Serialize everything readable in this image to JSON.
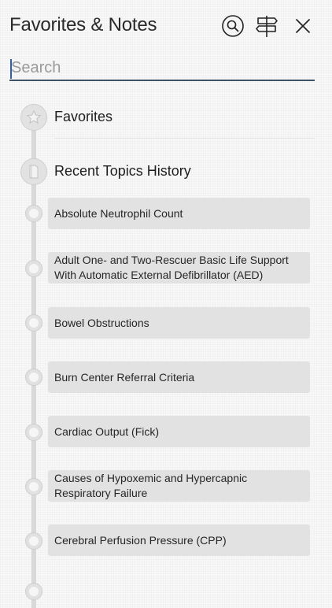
{
  "header": {
    "title": "Favorites & Notes",
    "icons": [
      "search-icon",
      "signpost-icon",
      "close-icon"
    ]
  },
  "search": {
    "placeholder": "Search",
    "value": ""
  },
  "sections": {
    "favorites": {
      "label": "Favorites",
      "icon": "star-icon"
    },
    "history": {
      "label": "Recent Topics History",
      "icon": "document-icon"
    }
  },
  "history_items": [
    "Absolute Neutrophil Count",
    "Adult One- and Two-Rescuer Basic Life Support With Automatic External Defibrillator (AED)",
    "Bowel Obstructions",
    "Burn Center Referral Criteria",
    "Cardiac Output (Fick)",
    "Causes of Hypoxemic and Hypercapnic Respiratory Failure",
    "Cerebral Perfusion Pressure (CPP)"
  ],
  "colors": {
    "accent": "#3f5268",
    "caret": "#2f5fae",
    "item_bg": "#e2e2e2",
    "timeline": "#d9d9d9"
  }
}
